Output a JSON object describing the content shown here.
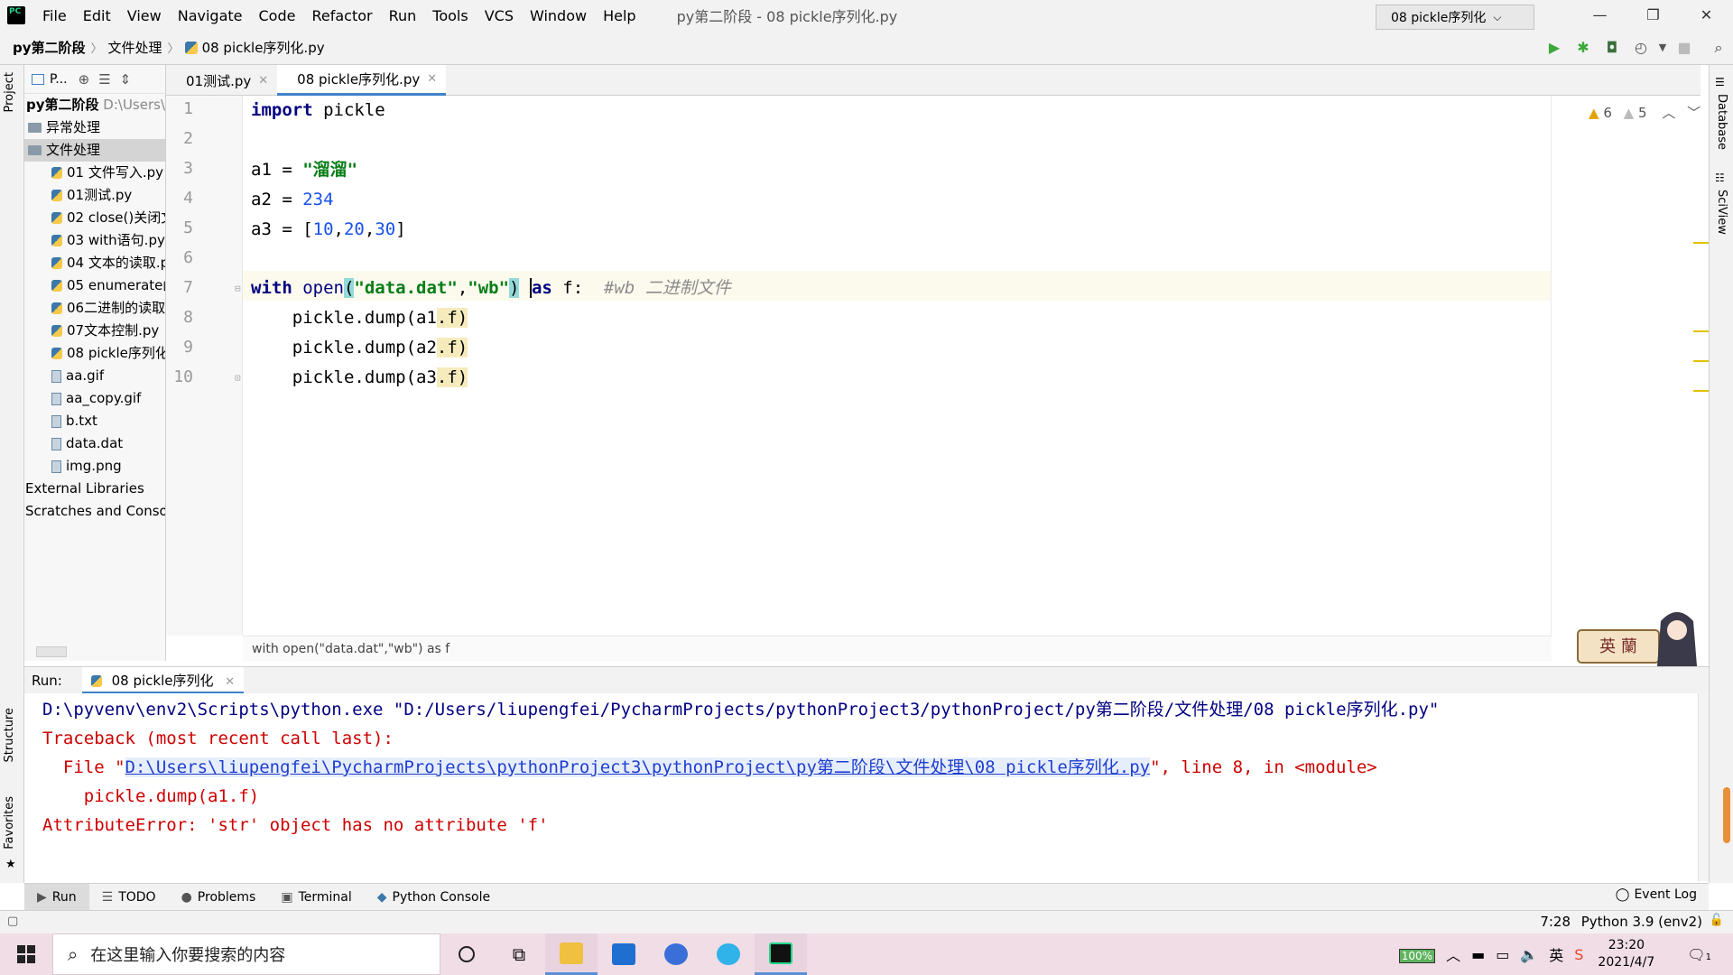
{
  "window": {
    "title": "py第二阶段 - 08 pickle序列化.py",
    "menu": [
      "File",
      "Edit",
      "View",
      "Navigate",
      "Code",
      "Refactor",
      "Run",
      "Tools",
      "VCS",
      "Window",
      "Help"
    ],
    "controls": [
      "—",
      "❐",
      "✕"
    ]
  },
  "navbar": {
    "crumbs": [
      "py第二阶段",
      "文件处理",
      "08 pickle序列化.py"
    ],
    "run_config": "08 pickle序列化"
  },
  "left_strip": {
    "project": "Project",
    "structure": "Structure",
    "favorites": "Favorites"
  },
  "right_strip": {
    "database": "Database",
    "sciview": "SciView"
  },
  "project": {
    "header": "P...",
    "root_name": "py第二阶段",
    "root_path": "D:\\Users\\l",
    "folders": [
      "异常处理",
      "文件处理"
    ],
    "files": [
      "01 文件写入.py",
      "01测试.py",
      "02 close()关闭文",
      "03 with语句.py",
      "04 文本的读取.p",
      "05 enumerate函",
      "06二进制的读取",
      "07文本控制.py",
      "08 pickle序列化"
    ],
    "other_files": [
      "aa.gif",
      "aa_copy.gif",
      "b.txt",
      "data.dat",
      "img.png"
    ],
    "extras": [
      "External Libraries",
      "Scratches and Consol"
    ]
  },
  "tabs": [
    {
      "label": "01测试.py",
      "active": false
    },
    {
      "label": "08 pickle序列化.py",
      "active": true
    }
  ],
  "editor": {
    "line_numbers": [
      "1",
      "2",
      "3",
      "4",
      "5",
      "6",
      "7",
      "8",
      "9",
      "10"
    ],
    "code": {
      "l1_kw": "import",
      "l1_rest": " pickle",
      "l3_var": "a1 = ",
      "l3_str": "\"溜溜\"",
      "l4_var": "a2 = ",
      "l4_num": "234",
      "l5_var": "a3 = [",
      "l5_n1": "10",
      "l5_c1": ",",
      "l5_n2": "20",
      "l5_c2": ",",
      "l5_n3": "30",
      "l5_end": "]",
      "l7_kw": "with",
      "l7_open": " open",
      "l7_lp": "(",
      "l7_s1": "\"data.dat\"",
      "l7_comma": ",",
      "l7_s2": "\"wb\"",
      "l7_rp": ")",
      "l7_sp": " ",
      "l7_as": "as",
      "l7_f": " f:  ",
      "l7_cmt": "#wb 二进制文件",
      "l8": "    pickle.dump(a1",
      "l8_w": ".f",
      "l8_end": ")",
      "l9": "    pickle.dump(a2",
      "l9_w": ".f",
      "l9_end": ")",
      "l10": "    pickle.dump(a3",
      "l10_w": ".f",
      "l10_end": ")"
    },
    "warnings": "6",
    "weak_warnings": "5",
    "breadcrumb": "with open(\"data.dat\",\"wb\") as f"
  },
  "run": {
    "label": "Run:",
    "tab": "08 pickle序列化",
    "output": {
      "cmd": "D:\\pyvenv\\env2\\Scripts\\python.exe \"D:/Users/liupengfei/PycharmProjects/pythonProject3/pythonProject/py第二阶段/文件处理/08 pickle序列化.py\"",
      "tb1": "Traceback (most recent call last):",
      "tb2_pre": "  File \"",
      "tb2_link": "D:\\Users\\liupengfei\\PycharmProjects\\pythonProject3\\pythonProject\\py第二阶段\\文件处理\\08 pickle序列化.py",
      "tb2_post": "\", line 8, in <module>",
      "tb3": "    pickle.dump(a1.f)",
      "err": "AttributeError: 'str' object has no attribute 'f'"
    }
  },
  "tool_tabs": [
    "Run",
    "TODO",
    "Problems",
    "Terminal",
    "Python Console"
  ],
  "event_log": "Event Log",
  "status": {
    "position": "7:28",
    "interpreter": "Python 3.9 (env2)"
  },
  "taskbar": {
    "search_placeholder": "在这里输入你要搜索的内容",
    "battery": "100%",
    "ime": "英",
    "time": "23:20",
    "date": "2021/4/7",
    "notifications": "1"
  },
  "deco_text": "英 蘭",
  "colors": {
    "accent": "#4083c9",
    "keyword": "#000080",
    "string": "#067d17",
    "number": "#1750eb",
    "error": "#cc0000"
  }
}
